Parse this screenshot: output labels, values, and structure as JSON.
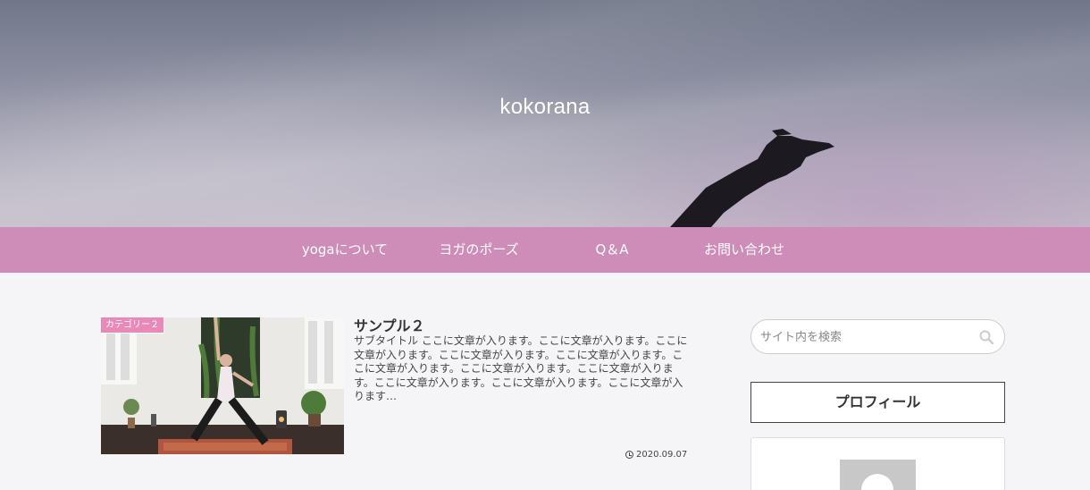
{
  "site": {
    "title": "kokorana"
  },
  "nav": {
    "items": [
      {
        "label": "yogaについて"
      },
      {
        "label": "ヨガのポーズ"
      },
      {
        "label": "Q＆A"
      },
      {
        "label": "お問い合わせ"
      }
    ]
  },
  "post": {
    "category": "カテゴリー２",
    "title": "サンプル２",
    "excerpt": "サブタイトル ここに文章が入ります。ここに文章が入ります。ここに文章が入ります。ここに文章が入ります。ここに文章が入ります。ここに文章が入ります。ここに文章が入ります。ここに文章が入ります。ここに文章が入ります。ここに文章が入ります。ここに文章が入ります…",
    "date": "2020.09.07"
  },
  "sidebar": {
    "search_placeholder": "サイト内を検索",
    "profile_title": "プロフィール"
  },
  "colors": {
    "nav_bg": "#cd8db8",
    "category_badge": "#e889b8"
  }
}
